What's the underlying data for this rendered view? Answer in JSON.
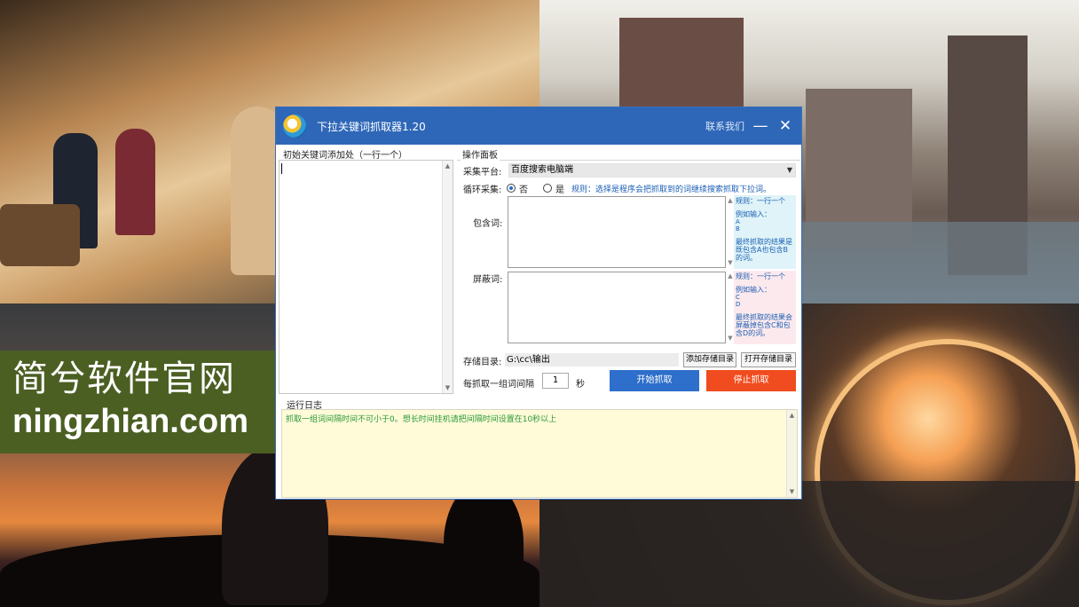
{
  "watermark": {
    "cn": "简兮软件官网",
    "domain": "ningzhian.com"
  },
  "window": {
    "title": "下拉关键词抓取器1.20",
    "contact": "联系我们",
    "minimize": "—",
    "close": "✕"
  },
  "left_panel": {
    "title": "初始关键词添加处（一行一个）"
  },
  "ops": {
    "title": "操作面板",
    "platform_label": "采集平台:",
    "platform_value": "百度搜索电脑端",
    "loop_label": "循环采集:",
    "loop_no": "否",
    "loop_yes": "是",
    "loop_selected": "否",
    "rule": "规则：选择是程序会把抓取到的词继续搜索抓取下拉词。",
    "include_label": "包含词:",
    "include_hint": {
      "line1": "规则：一行一个",
      "line2": "例如输入：",
      "line3": "A",
      "line4": "B",
      "line5": "最终抓取的结果是既包含A也包含B的词。"
    },
    "exclude_label": "屏蔽词:",
    "exclude_hint": {
      "line1": "规则：一行一个",
      "line2": "例如输入：",
      "line3": "C",
      "line4": "D",
      "line5": "最终抓取的结果会屏蔽掉包含C和包含D的词。"
    },
    "save_label": "存储目录:",
    "save_path": "G:\\cc\\输出",
    "add_dir_btn": "添加存储目录",
    "open_dir_btn": "打开存储目录",
    "interval_label": "每抓取一组词间隔",
    "interval_value": "1",
    "interval_unit": "秒",
    "start_btn": "开始抓取",
    "stop_btn": "停止抓取"
  },
  "log": {
    "title": "运行日志",
    "message": "抓取一组词间隔时间不可小于0。想长时间挂机请把间隔时间设置在10秒以上"
  },
  "colors": {
    "titlebar": "#2e67b8",
    "start": "#2d6fca",
    "stop": "#f04c1f",
    "log_bg": "#fffbd9",
    "watermark_bg": "#4b5f23"
  }
}
